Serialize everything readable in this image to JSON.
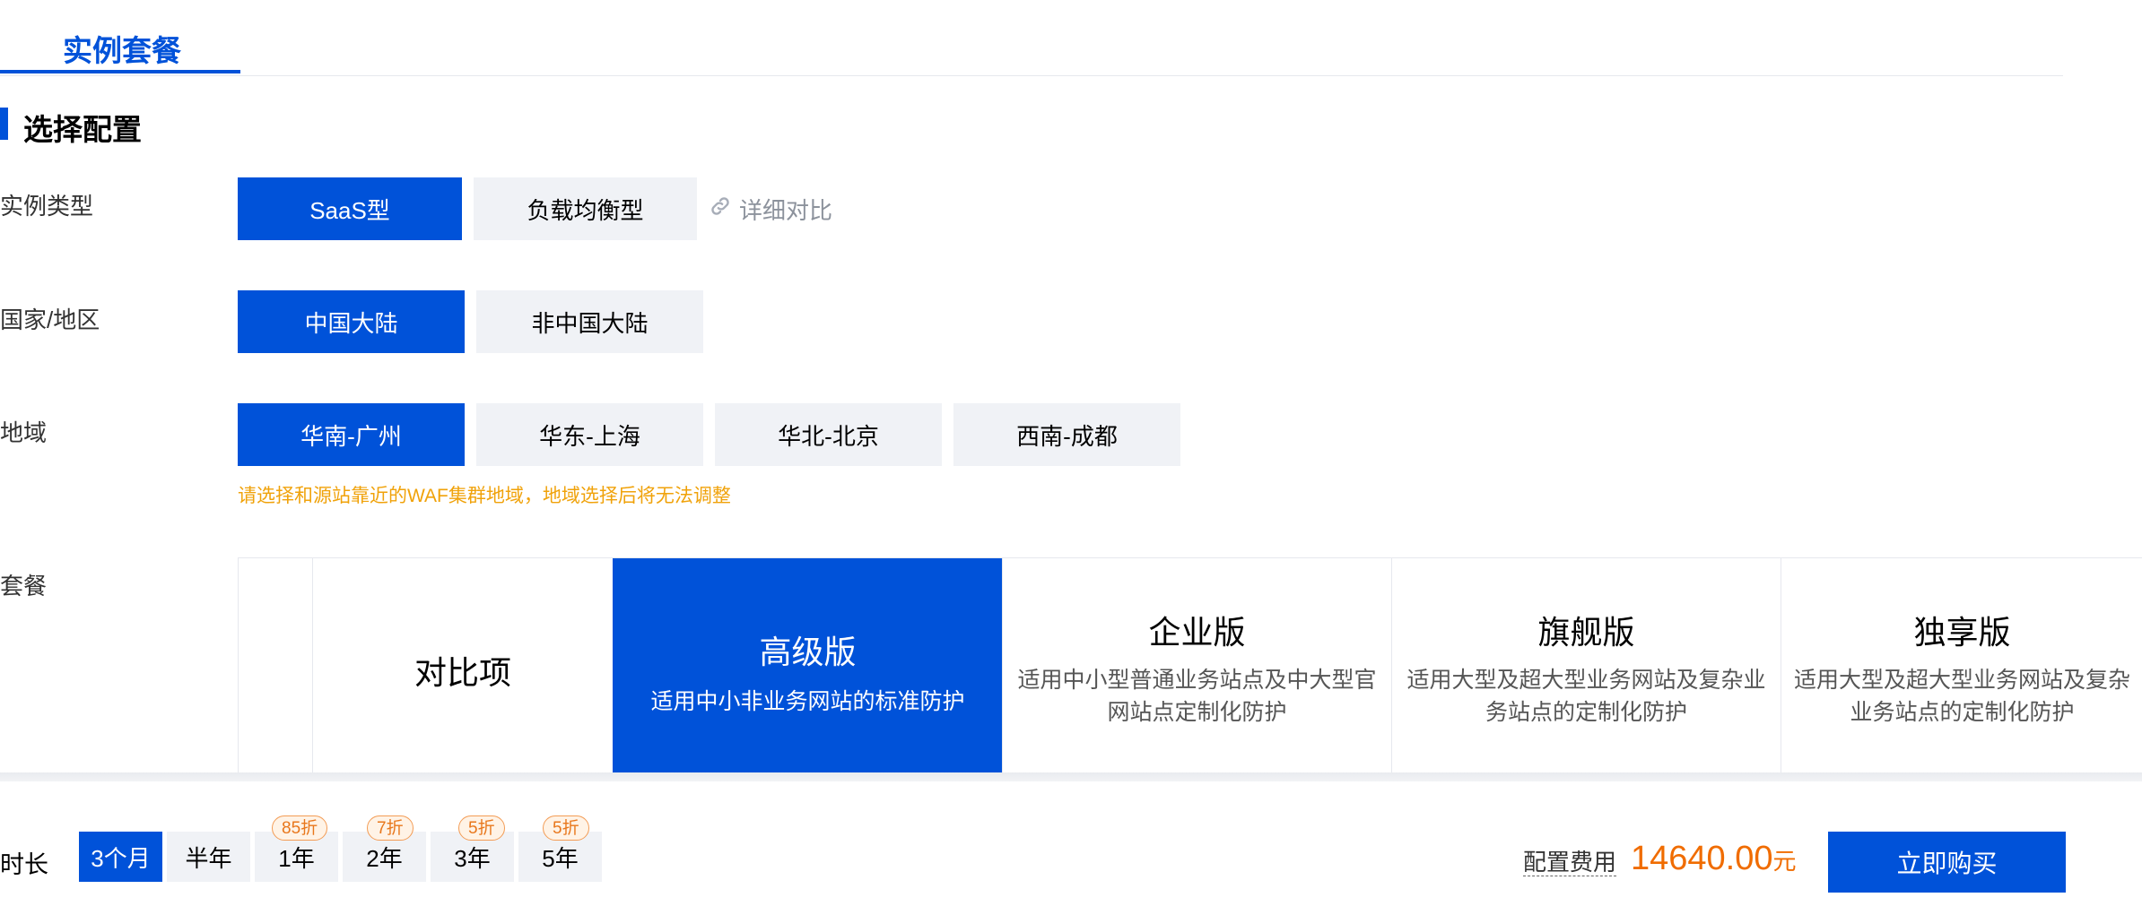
{
  "tabs": {
    "active": "实例套餐"
  },
  "section_title": "选择配置",
  "instance_type": {
    "label": "实例类型",
    "options": [
      "SaaS型",
      "负载均衡型"
    ],
    "selected": "SaaS型",
    "compare_link": "详细对比"
  },
  "region_country": {
    "label": "国家/地区",
    "options": [
      "中国大陆",
      "非中国大陆"
    ],
    "selected": "中国大陆"
  },
  "area": {
    "label": "地域",
    "options": [
      "华南-广州",
      "华东-上海",
      "华北-北京",
      "西南-成都"
    ],
    "selected": "华南-广州",
    "hint": "请选择和源站靠近的WAF集群地域，地域选择后将无法调整"
  },
  "package": {
    "label": "套餐",
    "compare_header": "对比项",
    "plans": [
      {
        "name": "高级版",
        "desc": "适用中小非业务网站的标准防护",
        "selected": true
      },
      {
        "name": "企业版",
        "desc": "适用中小型普通业务站点及中大型官网站点定制化防护"
      },
      {
        "name": "旗舰版",
        "desc": "适用大型及超大型业务网站及复杂业务站点的定制化防护"
      },
      {
        "name": "独享版",
        "desc": "适用大型及超大型业务网站及复杂业务站点的定制化防护"
      }
    ]
  },
  "duration": {
    "label": "时长",
    "options": [
      {
        "label": "3个月",
        "selected": true
      },
      {
        "label": "半年"
      },
      {
        "label": "1年",
        "badge": "85折"
      },
      {
        "label": "2年",
        "badge": "7折"
      },
      {
        "label": "3年",
        "badge": "5折"
      },
      {
        "label": "5年",
        "badge": "5折"
      }
    ]
  },
  "fee": {
    "label": "配置费用",
    "amount": "14640.00",
    "unit": "元"
  },
  "buy_button": "立即购买",
  "colors": {
    "primary": "#0052d9",
    "price": "#f06c00",
    "hint": "#f0a20a",
    "option_bg": "#f0f2f6"
  }
}
